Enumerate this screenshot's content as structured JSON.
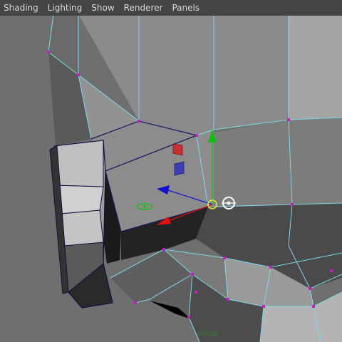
{
  "menu": {
    "items": [
      "Shading",
      "Lighting",
      "Show",
      "Renderer",
      "Panels"
    ]
  },
  "viewport": {
    "camera_label": "persp"
  },
  "colors": {
    "menubar_bg": "#444444",
    "wire": "#7fd8e8",
    "vertex": "#c020c0",
    "axis_x": "#e01010",
    "axis_y": "#10c010",
    "axis_z": "#1010d0"
  },
  "icons": {
    "move_manipulator": "move-manipulator-icon",
    "rotate_pivot": "rotate-pivot-icon"
  }
}
